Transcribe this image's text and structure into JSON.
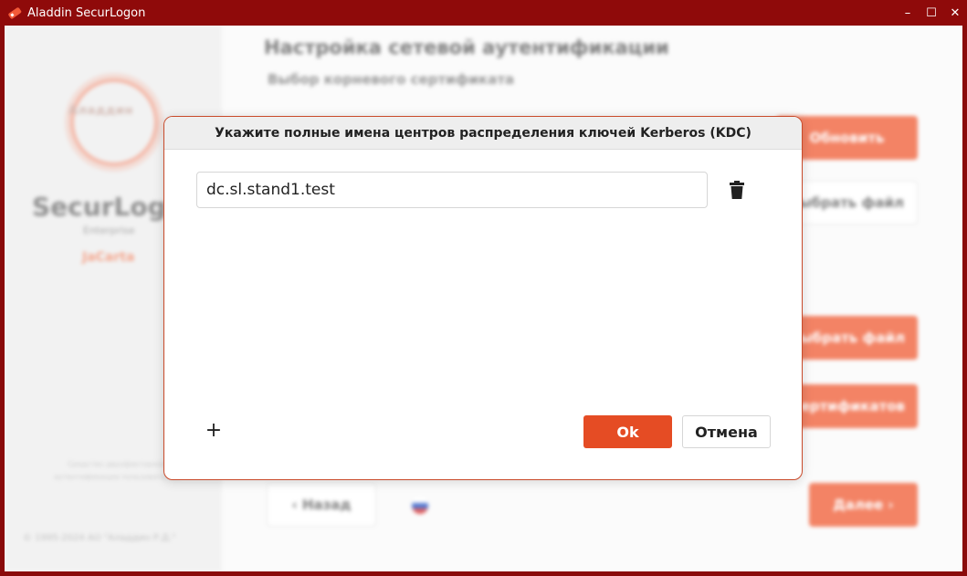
{
  "window": {
    "title": "Aladdin SecurLogon",
    "minimize": "–",
    "maximize": "☐",
    "close": "✕"
  },
  "sidebar": {
    "logo_text": "Аладдин",
    "brand": "SecurLogon",
    "edition": "Enterprise",
    "product": "JaCarta",
    "note": "Средство двухфакторной аутентификации пользователей",
    "copyright": "© 1995-2024 АО \"Аладдин Р.Д.\""
  },
  "main": {
    "title": "Настройка сетевой аутентификации",
    "subtitle": "Выбор корневого сертификата",
    "refresh_button": "Обновить",
    "choose_file_button_1": "ыбрать файл",
    "choose_file_button_2": "ыбрать файл",
    "certificates_button": "ертификатов",
    "back_button": "‹  Назад",
    "next_button": "Далее  ›"
  },
  "dialog": {
    "title": "Укажите полные имена центров распределения ключей Kerberos (KDC)",
    "kdc_entries": [
      "dc.sl.stand1.test"
    ],
    "add_label": "+",
    "ok_button": "Ok",
    "cancel_button": "Отмена"
  },
  "colors": {
    "titlebar": "#8f0a0a",
    "accent": "#e54c24",
    "dialog_border": "#c94a2a"
  }
}
